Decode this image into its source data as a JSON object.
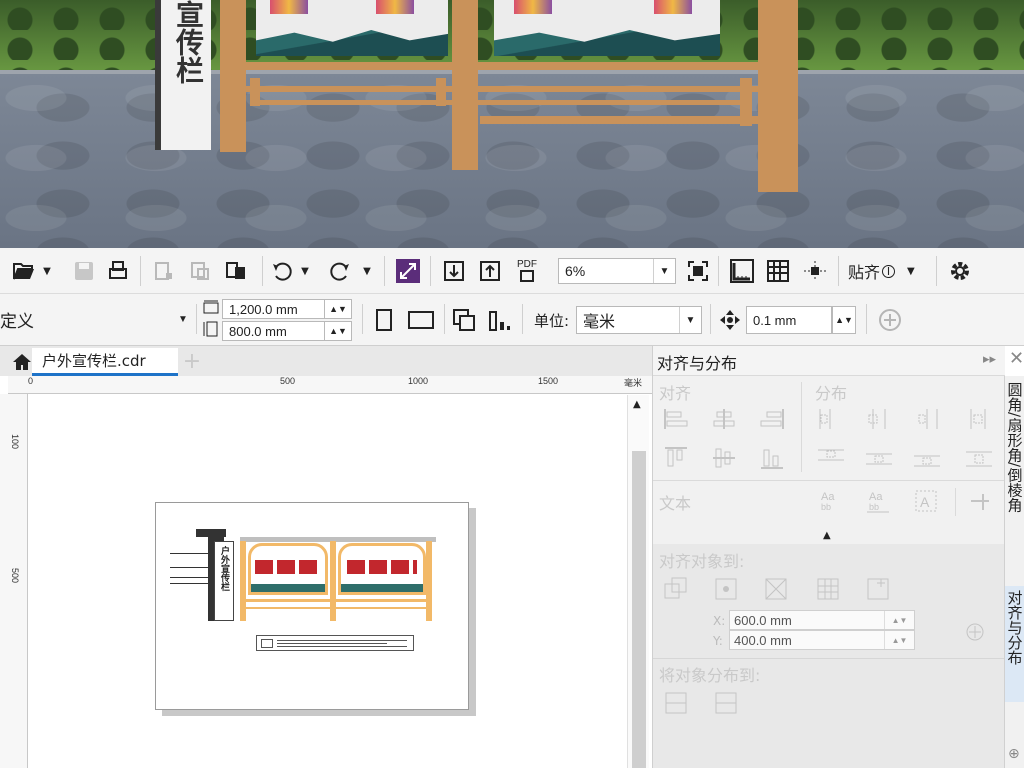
{
  "scene": {
    "sign_text": "宣传栏"
  },
  "toolbar1": {
    "zoom_value": "6%",
    "snap_label": "贴齐",
    "pdf_label": "PDF"
  },
  "toolbar2": {
    "preset_value": "定义",
    "width_value": "1,200.0 mm",
    "height_value": "800.0 mm",
    "units_label": "单位:",
    "units_value": "毫米",
    "nudge_value": "0.1 mm"
  },
  "document": {
    "tab_title": "户外宣传栏.cdr",
    "ruler_h_ticks": [
      "0",
      "500",
      "1000",
      "1500",
      "毫米"
    ],
    "ruler_v_ticks": [
      "100",
      "500"
    ],
    "page_sign_text": "户外宣传栏"
  },
  "docker": {
    "title": "对齐与分布",
    "align_label": "对齐",
    "distribute_label": "分布",
    "text_label": "文本",
    "align_to_label": "对齐对象到:",
    "x_label": "X:",
    "x_value": "600.0 mm",
    "y_label": "Y:",
    "y_value": "400.0 mm",
    "distribute_to_label": "将对象分布到:"
  },
  "side_tabs": {
    "tab1": "圆角/扇形角/倒棱角",
    "tab2": "对齐与分布"
  },
  "colors": {
    "accent": "#1e73c8",
    "wood": "#c9925a",
    "toolbar_bg": "#f4f4f4"
  }
}
